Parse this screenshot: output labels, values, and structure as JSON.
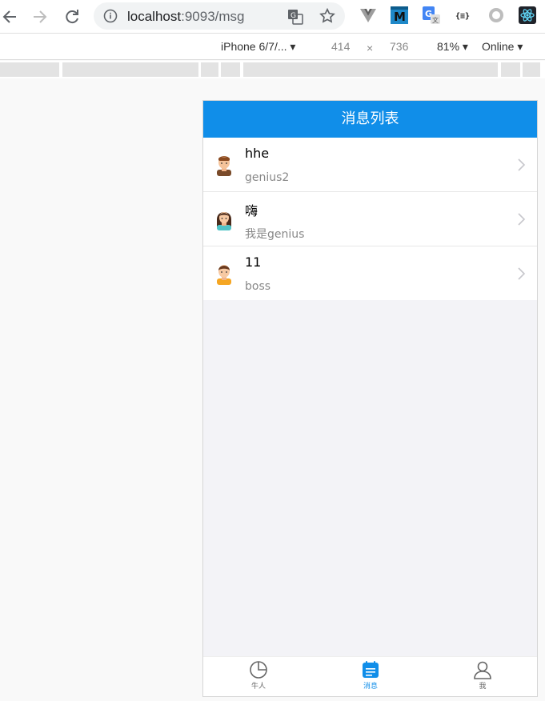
{
  "browser": {
    "url_host": "localhost",
    "url_path": ":9093/msg"
  },
  "device_toolbar": {
    "device": "iPhone 6/7/...",
    "width": "414",
    "times": "×",
    "height": "736",
    "zoom": "81%",
    "network": "Online"
  },
  "app": {
    "title": "消息列表",
    "messages": [
      {
        "title": "hhe",
        "subtitle": "genius2",
        "avatar": "man-avatar-icon"
      },
      {
        "title": "嗨",
        "subtitle": "我是genius",
        "avatar": "woman-avatar-icon"
      },
      {
        "title": "11",
        "subtitle": "boss",
        "avatar": "boy-avatar-icon"
      }
    ],
    "tabs": [
      {
        "label": "牛人",
        "icon": "pie-chart-icon",
        "active": false
      },
      {
        "label": "消息",
        "icon": "calendar-icon",
        "active": true
      },
      {
        "label": "我",
        "icon": "user-icon",
        "active": false
      }
    ],
    "accent_color": "#108ee9"
  }
}
